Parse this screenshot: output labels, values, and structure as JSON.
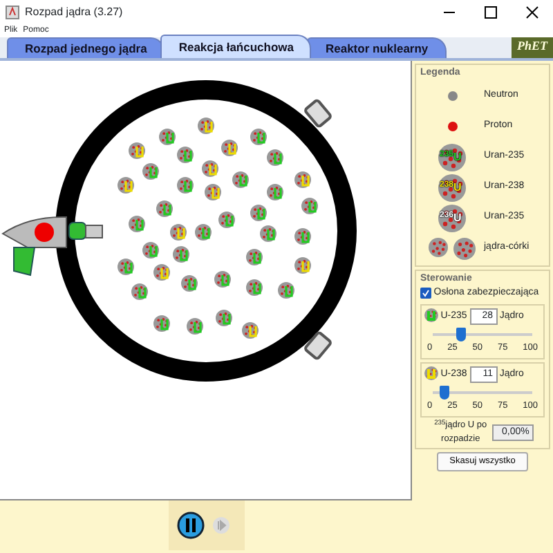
{
  "window": {
    "title": "Rozpad jądra (3.27)"
  },
  "menu": [
    "Plik",
    "Pomoc"
  ],
  "tabs": [
    {
      "label": "Rozpad jednego jądra",
      "selected": false
    },
    {
      "label": "Reakcja łańcuchowa",
      "selected": true
    },
    {
      "label": "Reaktor nuklearny",
      "selected": false
    }
  ],
  "logo": "PhET",
  "legend": {
    "title": "Legenda",
    "items": [
      {
        "kind": "neutron",
        "label": "Neutron"
      },
      {
        "kind": "proton",
        "label": "Proton"
      },
      {
        "kind": "nucleus",
        "symbol": "$^{235}$U",
        "color": "#22cc22",
        "label": "Uran-235"
      },
      {
        "kind": "nucleus",
        "symbol": "$^{238}$U",
        "color": "#eedd00",
        "label": "Uran-238"
      },
      {
        "kind": "nucleus",
        "symbol": "$^{236}$U",
        "color": "#ffffff",
        "label": "Uran-235"
      },
      {
        "kind": "fragments",
        "label": "jądra-córki"
      }
    ]
  },
  "controls": {
    "title": "Sterowanie",
    "shield": {
      "label": "Osłona zabezpieczająca",
      "checked": true
    },
    "sliders": [
      {
        "name": "U-235",
        "color": "#22cc22",
        "value": "28",
        "unit": "Jądro",
        "level": 0.28,
        "ticks": [
          "0",
          "25",
          "50",
          "75",
          "100"
        ]
      },
      {
        "name": "U-238",
        "color": "#eedd00",
        "value": "11",
        "unit": "Jądro",
        "level": 0.11,
        "ticks": [
          "0",
          "25",
          "50",
          "75",
          "100"
        ]
      }
    ],
    "decayed": {
      "label": "$^{235}$jądro U po rozpadzie",
      "value": "0,00%"
    },
    "reset": "Skasuj wszystko"
  },
  "playback": {
    "paused": false
  }
}
